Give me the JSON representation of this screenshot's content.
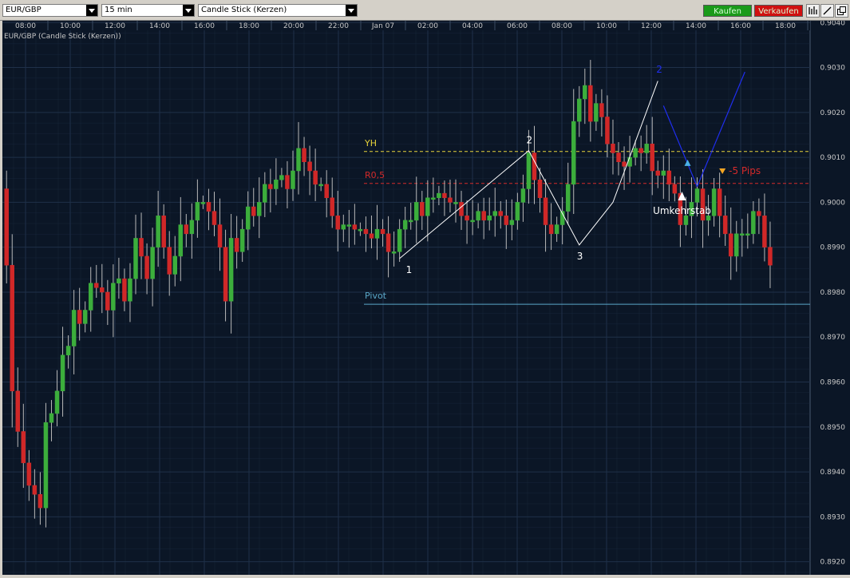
{
  "toolbar": {
    "symbol": "EUR/GBP",
    "interval": "15 min",
    "chart_type": "Candle Stick (Kerzen)",
    "buy_label": "Kaufen",
    "sell_label": "Verkaufen",
    "buy_color": "#1a9a1a",
    "sell_color": "#d01010",
    "icons": [
      "bar-chart-icon",
      "draw-line-icon",
      "popout-window-icon"
    ]
  },
  "chart_title": "EUR/GBP (Candle Stick (Kerzen))",
  "colors": {
    "background": "#0b1626",
    "grid": "#1f3049",
    "bull": "#3cae3c",
    "bear": "#d02828",
    "yh": "#e6d23a",
    "r05": "#d42a2a",
    "pivot": "#5aa7c8",
    "zigzag": "#ffffff",
    "trend": "#1f2ef0"
  },
  "chart_data": {
    "type": "candlestick",
    "time_labels": [
      "08:00",
      "10:00",
      "12:00",
      "14:00",
      "16:00",
      "18:00",
      "20:00",
      "22:00",
      "Jan 07",
      "02:00",
      "04:00",
      "06:00",
      "08:00",
      "10:00",
      "12:00",
      "14:00",
      "16:00",
      "18:00"
    ],
    "y_ticks": [
      "0.9040",
      "0.9030",
      "0.9020",
      "0.9010",
      "0.9000",
      "0.8990",
      "0.8980",
      "0.8970",
      "0.8960",
      "0.8950",
      "0.8940",
      "0.8930",
      "0.8920"
    ],
    "ylim": [
      0.89171,
      0.90404
    ],
    "close": [
      0.8986,
      0.8958,
      0.8949,
      0.8942,
      0.8937,
      0.8935,
      0.8932,
      0.8951,
      0.8953,
      0.8958,
      0.8966,
      0.8968,
      0.8976,
      0.8973,
      0.8976,
      0.8982,
      0.8981,
      0.898,
      0.8976,
      0.8982,
      0.8983,
      0.8978,
      0.8983,
      0.8992,
      0.8988,
      0.8983,
      0.899,
      0.8997,
      0.899,
      0.8984,
      0.8988,
      0.8995,
      0.8993,
      0.8996,
      0.9,
      0.9,
      0.8998,
      0.8995,
      0.899,
      0.8978,
      0.8992,
      0.8989,
      0.8994,
      0.8999,
      0.8997,
      0.9,
      0.9004,
      0.9003,
      0.9005,
      0.9006,
      0.9003,
      0.9007,
      0.9012,
      0.9009,
      0.9007,
      0.9004,
      0.9004,
      0.9001,
      0.8997,
      0.8994,
      0.8995,
      0.8995,
      0.8994,
      0.8994,
      0.8993,
      0.8992,
      0.8994,
      0.8993,
      0.8989,
      0.8989,
      0.8994,
      0.8996,
      0.8996,
      0.9,
      0.8997,
      0.9001,
      0.9001,
      0.9002,
      0.9001,
      0.9,
      0.9,
      0.8997,
      0.8996,
      0.8996,
      0.8998,
      0.8996,
      0.8997,
      0.8998,
      0.8997,
      0.8995,
      0.8996,
      0.9,
      0.9003,
      0.9011,
      0.9005,
      0.9001,
      0.8995,
      0.8993,
      0.8995,
      0.8998,
      0.9004,
      0.9018,
      0.9023,
      0.9026,
      0.9018,
      0.9022,
      0.9019,
      0.9013,
      0.9011,
      0.9009,
      0.9008,
      0.901,
      0.9012,
      0.9011,
      0.9013,
      0.9007,
      0.9006,
      0.9007,
      0.9004,
      0.9002,
      0.8995,
      0.8997,
      0.9,
      0.9003,
      0.8996,
      0.8997,
      0.9003,
      0.8997,
      0.8993,
      0.8988,
      0.8993,
      0.8993,
      0.8993,
      0.8998,
      0.8997,
      0.899,
      0.8986
    ],
    "series_note": "",
    "levels": [
      {
        "name": "YH",
        "value": 0.90113
      },
      {
        "name": "R0,5",
        "value": 0.90042
      },
      {
        "name": "Pivot",
        "value": 0.89773
      }
    ],
    "wave_labels": [
      "1",
      "2",
      "3"
    ],
    "annotations": {
      "reversal": "Umkehrstab",
      "stop": "-5 Pips",
      "trend_number": "2"
    }
  }
}
